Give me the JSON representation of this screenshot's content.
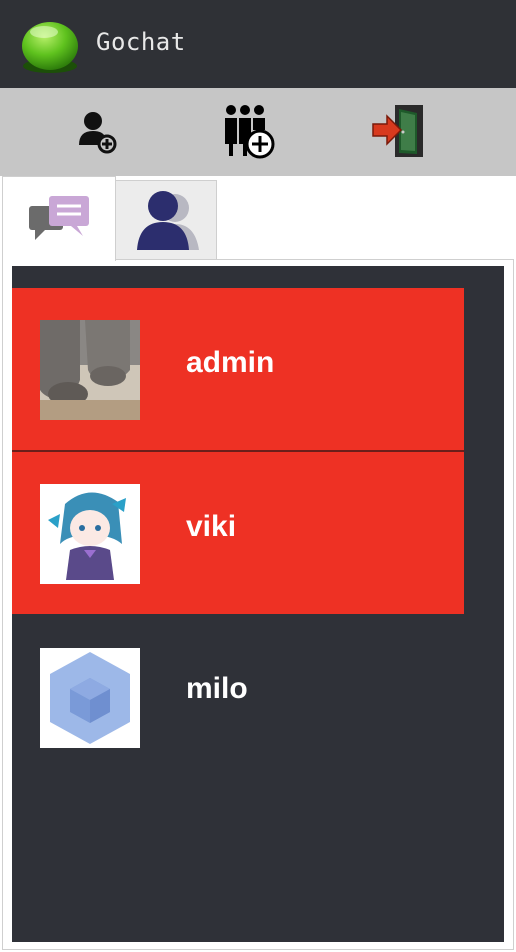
{
  "app": {
    "title": "Gochat"
  },
  "toolbar": {
    "buttons": [
      {
        "icon": "add-friend-icon"
      },
      {
        "icon": "create-group-icon"
      },
      {
        "icon": "logout-icon"
      }
    ]
  },
  "tabs": [
    {
      "icon": "chat-bubbles-icon",
      "active": true
    },
    {
      "icon": "contacts-icon",
      "active": false
    }
  ],
  "users": [
    {
      "name": "admin",
      "avatar": "cat-paws-avatar",
      "selected": true
    },
    {
      "name": "viki",
      "avatar": "anime-girl-avatar",
      "selected": true
    },
    {
      "name": "milo",
      "avatar": "blue-cube-avatar",
      "selected": false
    }
  ],
  "colors": {
    "titlebar": "#2f3136",
    "toolbar": "#c6c6c6",
    "panel": "#2f3138",
    "selected": "#ee3124"
  }
}
